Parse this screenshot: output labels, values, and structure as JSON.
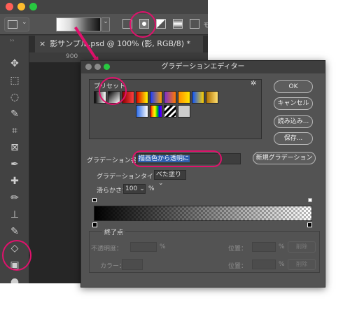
{
  "app": {
    "tab_title": "影サンプル.psd @ 100% (影, RGB/8) *",
    "ruler_labels": [
      "900"
    ],
    "tools": [
      {
        "name": "move-tool",
        "glyph": "✥"
      },
      {
        "name": "marquee-tool",
        "glyph": "⬚"
      },
      {
        "name": "lasso-tool",
        "glyph": "◌"
      },
      {
        "name": "quick-select-tool",
        "glyph": "✎"
      },
      {
        "name": "crop-tool",
        "glyph": "⌗"
      },
      {
        "name": "frame-tool",
        "glyph": "⊠"
      },
      {
        "name": "eyedropper-tool",
        "glyph": "✒"
      },
      {
        "name": "healing-tool",
        "glyph": "✚"
      },
      {
        "name": "brush-tool",
        "glyph": "✏"
      },
      {
        "name": "stamp-tool",
        "glyph": "⊥"
      },
      {
        "name": "history-brush-tool",
        "glyph": "✎"
      },
      {
        "name": "eraser-tool",
        "glyph": "◇"
      },
      {
        "name": "gradient-tool",
        "glyph": "▣"
      },
      {
        "name": "blur-tool",
        "glyph": "●"
      }
    ]
  },
  "dialog": {
    "title": "グラデーションエディター",
    "presets_label": "プリセット",
    "ok_label": "OK",
    "cancel_label": "キャンセル",
    "load_label": "読み込み...",
    "save_label": "保存...",
    "name_label": "グラデーション名：",
    "name_value": "描画色から透明に",
    "new_gradient_label": "新規グラデーション",
    "type_label": "グラデーションタイプ：",
    "type_value": "べた塗り",
    "smoothness_label": "滑らかさ：",
    "smoothness_value": "100",
    "percent": "%",
    "stops_label": "終了点",
    "opacity_label": "不透明度：",
    "location_label": "位置：",
    "delete_label": "削除",
    "color_label": "カラー："
  },
  "colors": {
    "annotation": "#e0116c",
    "close": "#ff5f57",
    "minimize": "#febc2e",
    "zoom": "#28c840"
  }
}
